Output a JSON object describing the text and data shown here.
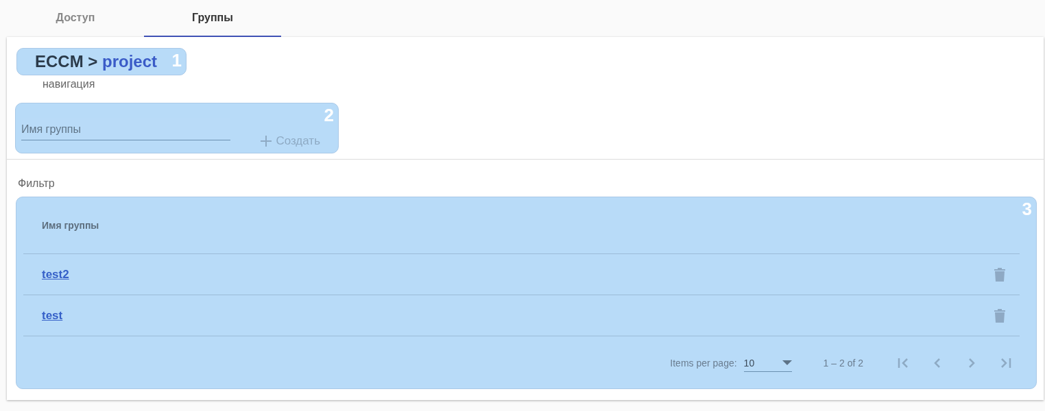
{
  "tabs": [
    {
      "label": "Доступ",
      "selected": false
    },
    {
      "label": "Группы",
      "selected": true
    }
  ],
  "breadcrumb": {
    "root": "ECCM",
    "separator": ">",
    "current": "project",
    "badge": "1",
    "caption": "навигация"
  },
  "create_form": {
    "badge": "2",
    "field": {
      "placeholder": "Имя группы"
    },
    "button": {
      "label": "Создать",
      "disabled": true
    }
  },
  "filter": {
    "label": "Фильтр"
  },
  "table": {
    "badge": "3",
    "columns": [
      "Имя группы"
    ],
    "rows": [
      {
        "name": "test2"
      },
      {
        "name": "test"
      }
    ],
    "paginator": {
      "items_label": "Items per page:",
      "page_size": "10",
      "range": "1 – 2 of 2",
      "buttons": [
        {
          "kind": "first",
          "disabled": true
        },
        {
          "kind": "prev",
          "disabled": true
        },
        {
          "kind": "next",
          "disabled": true
        },
        {
          "kind": "last",
          "disabled": true
        }
      ]
    }
  }
}
